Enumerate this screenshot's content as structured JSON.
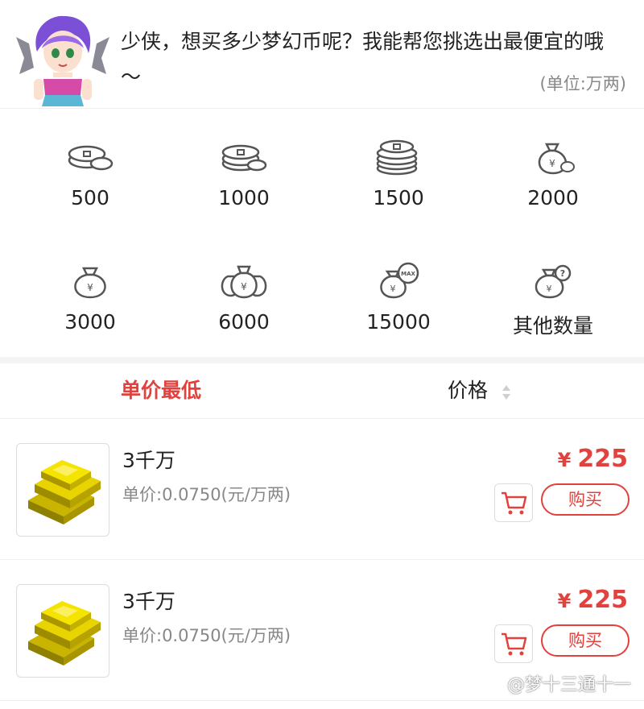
{
  "header": {
    "prompt": "少侠，想买多少梦幻币呢？我能帮您挑选出最便宜的哦～",
    "unit_note": "(单位:万两)"
  },
  "amounts": [
    {
      "label": "500",
      "icon": "coins-small-icon"
    },
    {
      "label": "1000",
      "icon": "coins-stack-icon"
    },
    {
      "label": "1500",
      "icon": "coins-tall-stack-icon"
    },
    {
      "label": "2000",
      "icon": "money-bag-icon"
    },
    {
      "label": "3000",
      "icon": "money-bag-icon"
    },
    {
      "label": "6000",
      "icon": "money-bags-icon"
    },
    {
      "label": "15000",
      "icon": "money-bag-max-icon"
    },
    {
      "label": "其他数量",
      "icon": "money-bag-question-icon"
    }
  ],
  "sort": {
    "lowest_unit": "单价最低",
    "price": "价格"
  },
  "listings": [
    {
      "name": "3千万",
      "unit_price": "单价:0.0750(元/万两)",
      "currency": "¥",
      "price": "225",
      "buy_label": "购买"
    },
    {
      "name": "3千万",
      "unit_price": "单价:0.0750(元/万两)",
      "currency": "¥",
      "price": "225",
      "buy_label": "购买"
    }
  ],
  "watermark": "@梦十三通十一",
  "colors": {
    "accent": "#e2423d",
    "muted": "#888888",
    "border": "#dcdcdc"
  }
}
